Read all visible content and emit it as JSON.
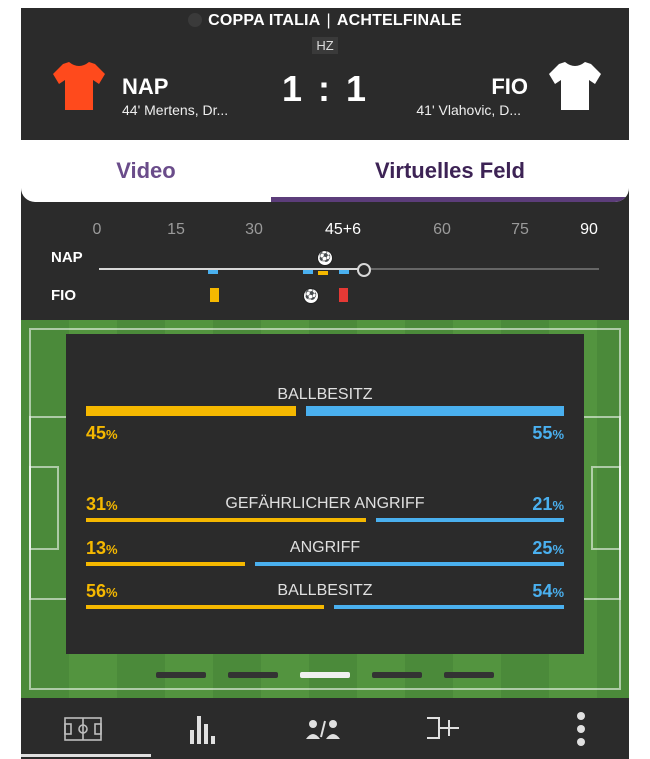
{
  "match": {
    "competition": "COPPA ITALIA",
    "round": "ACHTELFINALE",
    "status": "HZ",
    "home": {
      "short": "NAP",
      "scorers": "44' Mertens, Dr...",
      "jersey_color": "#ff4a1c"
    },
    "away": {
      "short": "FIO",
      "scorers": "41' Vlahovic, D...",
      "jersey_color": "#ffffff"
    },
    "score_home": "1",
    "score_sep": ":",
    "score_away": "1"
  },
  "tabs": [
    {
      "label": "Video",
      "active": false
    },
    {
      "label": "Virtuelles Feld",
      "active": true
    }
  ],
  "timeline": {
    "ticks": [
      "0",
      "15",
      "30",
      "45+6",
      "60",
      "75",
      "90"
    ],
    "home_label": "NAP",
    "away_label": "FIO",
    "current_minute": "45+6"
  },
  "stats": [
    {
      "label": "BALLBESITZ",
      "home": 45,
      "away": 55,
      "unit": "%"
    },
    {
      "label": "GEFÄHRLICHER ANGRIFF",
      "home": 31,
      "away": 21,
      "unit": "%"
    },
    {
      "label": "ANGRIFF",
      "home": 13,
      "away": 25,
      "unit": "%"
    },
    {
      "label": "BALLBESITZ",
      "home": 56,
      "away": 54,
      "unit": "%"
    }
  ],
  "pager": {
    "count": 5,
    "active_index": 2
  },
  "bottom_nav": [
    {
      "icon": "pitch-icon",
      "active": true
    },
    {
      "icon": "bar-chart-icon",
      "active": false
    },
    {
      "icon": "lineups-icon",
      "active": false
    },
    {
      "icon": "bracket-icon",
      "active": false
    },
    {
      "icon": "more-vertical-icon",
      "active": false
    }
  ],
  "colors": {
    "home": "#f5b800",
    "away": "#4ab0ef",
    "accent": "#5c3d7a",
    "red_card": "#e53935"
  }
}
